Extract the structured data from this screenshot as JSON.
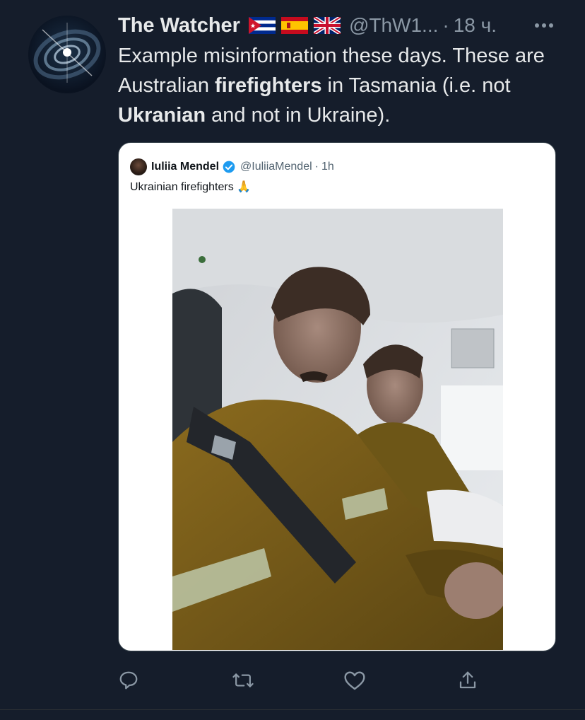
{
  "author": {
    "display_name": "The Watcher",
    "handle": "@ThW1...",
    "separator": "·",
    "time": "18 ч.",
    "flags": [
      "flag-cuba-icon",
      "flag-spain-icon",
      "flag-uk-icon"
    ]
  },
  "tweet": {
    "segments": [
      {
        "text": "Example misinformation these days. These are Australian ",
        "bold": false
      },
      {
        "text": "firefighters",
        "bold": true
      },
      {
        "text": " in Tasmania (i.e. not ",
        "bold": false
      },
      {
        "text": "Ukranian",
        "bold": true
      },
      {
        "text": " and not in Ukraine).",
        "bold": false
      }
    ]
  },
  "quoted": {
    "name": "Iuliia Mendel",
    "handle": "@IuliiaMendel",
    "separator": "·",
    "time": "1h",
    "text": "Ukrainian firefighters 🙏"
  },
  "actions": [
    "reply-icon",
    "retweet-icon",
    "like-icon",
    "share-icon"
  ],
  "colors": {
    "background": "#151d2b",
    "text": "#e7e9ea",
    "muted": "#8b98a5",
    "verified": "#1d9bf0"
  }
}
